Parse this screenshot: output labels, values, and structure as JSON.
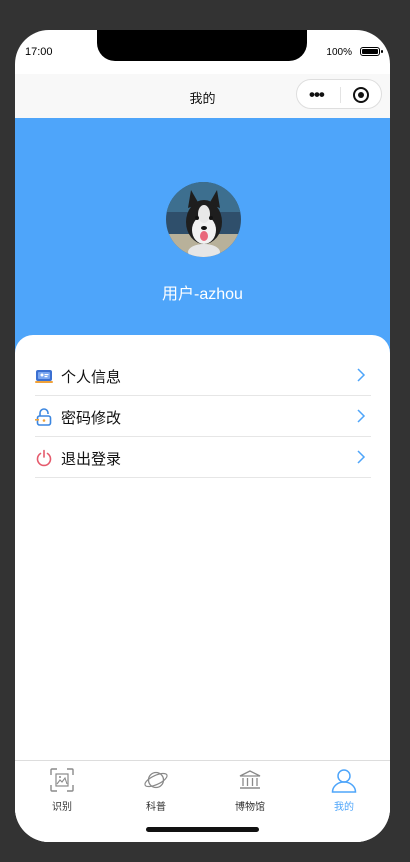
{
  "status_bar": {
    "time": "17:00",
    "battery": "100%"
  },
  "navbar": {
    "title": "我的",
    "more_icon": "more-dots-icon",
    "close_icon": "target-icon"
  },
  "profile": {
    "username": "用户-azhou",
    "avatar": "husky-dog-avatar"
  },
  "colors": {
    "accent": "#4ea5fa",
    "banner": "#4ea5fa",
    "divider": "#e6e6e6",
    "text": "#111111"
  },
  "menu": [
    {
      "label": "个人信息",
      "icon": "id-card-icon"
    },
    {
      "label": "密码修改",
      "icon": "lock-icon"
    },
    {
      "label": "退出登录",
      "icon": "power-icon"
    }
  ],
  "tabbar": [
    {
      "label": "识别",
      "icon": "image-scan-icon",
      "active": false
    },
    {
      "label": "科普",
      "icon": "planet-icon",
      "active": false
    },
    {
      "label": "博物馆",
      "icon": "museum-icon",
      "active": false
    },
    {
      "label": "我的",
      "icon": "user-icon",
      "active": true
    }
  ]
}
